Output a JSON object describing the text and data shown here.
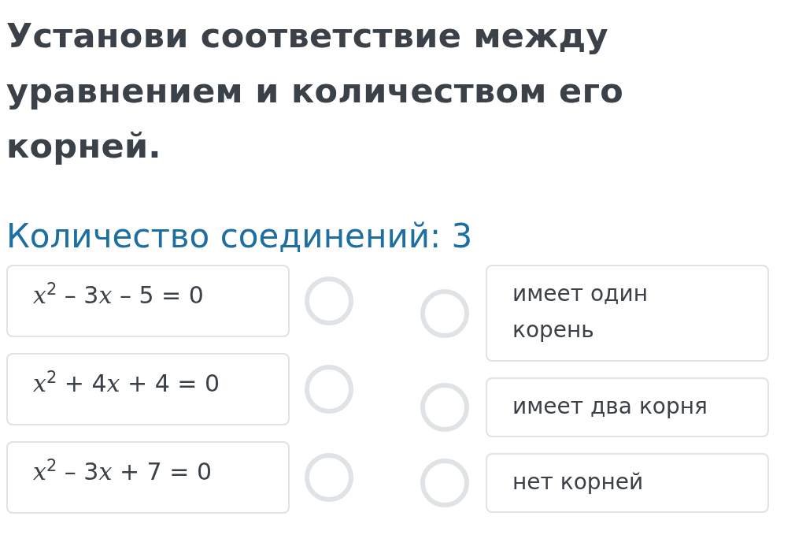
{
  "title": "Установи соответствие между уравнением и количеством его корней.",
  "connections": "Количество соединений: 3",
  "equations": [
    {
      "selected": false,
      "segments": [
        {
          "kind": "var",
          "text": "x"
        },
        {
          "kind": "sup",
          "text": "2"
        },
        {
          "kind": "plain",
          "text": " – 3"
        },
        {
          "kind": "var",
          "text": "x"
        },
        {
          "kind": "plain",
          "text": " – 5 = 0"
        }
      ]
    },
    {
      "selected": false,
      "segments": [
        {
          "kind": "var",
          "text": "x"
        },
        {
          "kind": "sup",
          "text": "2"
        },
        {
          "kind": "plain",
          "text": " + 4"
        },
        {
          "kind": "var",
          "text": "x"
        },
        {
          "kind": "plain",
          "text": " + 4 = 0"
        }
      ]
    },
    {
      "selected": false,
      "segments": [
        {
          "kind": "var",
          "text": "x"
        },
        {
          "kind": "sup",
          "text": "2"
        },
        {
          "kind": "plain",
          "text": " – 3"
        },
        {
          "kind": "var",
          "text": "x"
        },
        {
          "kind": "plain",
          "text": " + 7 = 0"
        }
      ]
    }
  ],
  "answers": [
    {
      "text": "имеет один корень",
      "selected": false
    },
    {
      "text": "имеет два корня",
      "selected": false
    },
    {
      "text": "нет корней",
      "selected": false
    }
  ]
}
